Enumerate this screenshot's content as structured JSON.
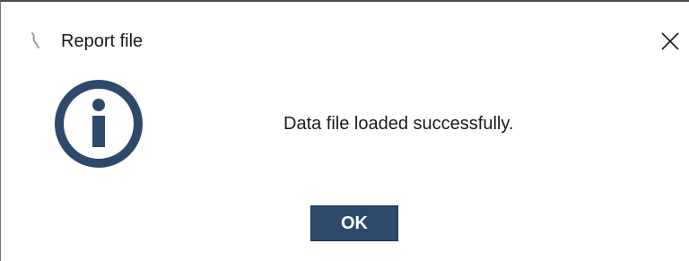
{
  "dialog": {
    "title": "Report file",
    "message": "Data file loaded successfully.",
    "ok_label": "OK"
  },
  "icons": {
    "app": "app-logo-icon",
    "close": "close-icon",
    "info": "info-icon"
  },
  "colors": {
    "info_icon": "#2d4a6c",
    "ok_button_bg": "#2d4a6c",
    "ok_button_text": "#ffffff",
    "text": "#1a1a1a"
  }
}
